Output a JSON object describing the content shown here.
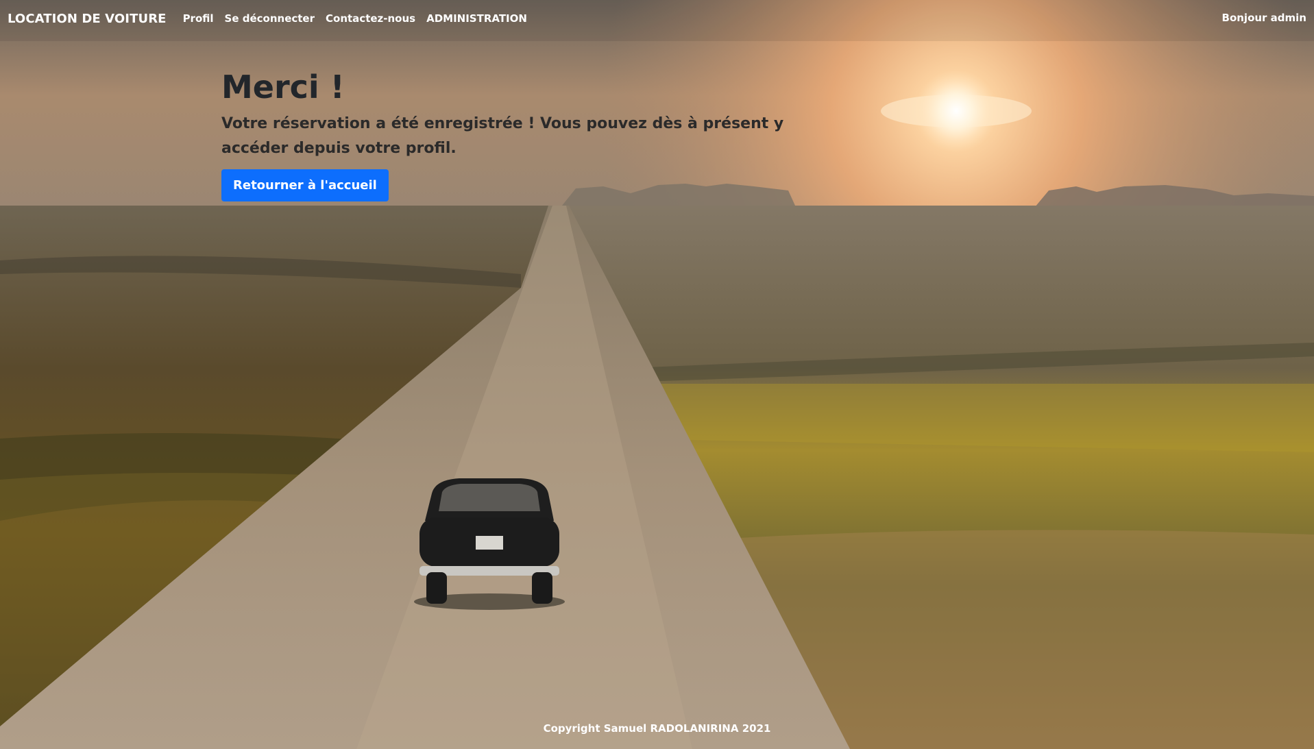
{
  "navbar": {
    "brand": "LOCATION DE VOITURE",
    "links": [
      {
        "label": "Profil"
      },
      {
        "label": "Se déconnecter"
      },
      {
        "label": "Contactez-nous"
      },
      {
        "label": "ADMINISTRATION"
      }
    ],
    "greeting": "Bonjour admin"
  },
  "hero": {
    "title": "Merci !",
    "message": "Votre réservation a été enregistrée ! Vous pouvez dès à présent y accéder depuis votre profil.",
    "button_label": "Retourner à l'accueil"
  },
  "footer": {
    "copyright": "Copyright Samuel RADOLANIRINA 2021"
  },
  "colors": {
    "button_bg": "#0d6efd",
    "title_text": "#22262b",
    "nav_text": "#ffffff"
  },
  "icons": {
    "background": "background-photo-road-car-sunset"
  }
}
